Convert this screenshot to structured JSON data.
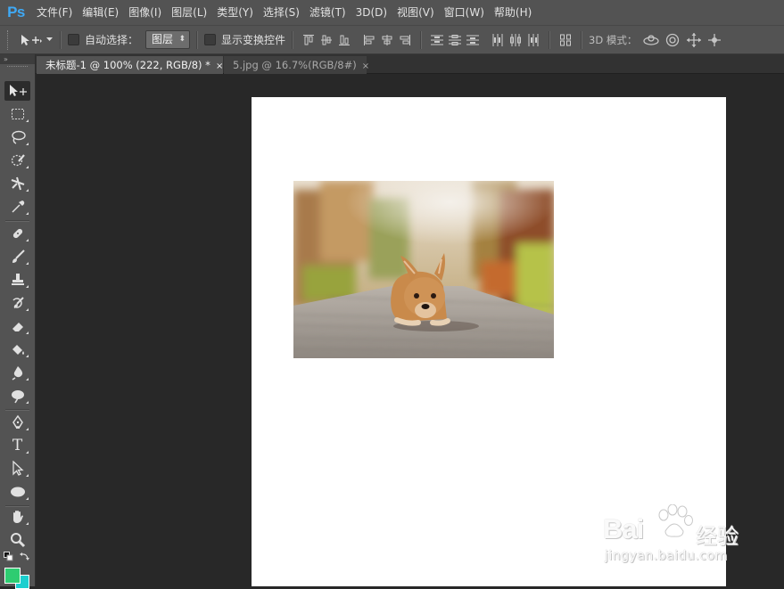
{
  "app": {
    "logo": "Ps"
  },
  "menu": [
    "文件(F)",
    "编辑(E)",
    "图像(I)",
    "图层(L)",
    "类型(Y)",
    "选择(S)",
    "滤镜(T)",
    "3D(D)",
    "视图(V)",
    "窗口(W)",
    "帮助(H)"
  ],
  "options": {
    "auto_select_label": "自动选择：",
    "auto_select_checked": false,
    "auto_select_target": "图层",
    "show_transform_label": "显示变换控件",
    "show_transform_checked": false,
    "mode_3d_label": "3D 模式："
  },
  "toolbox": {
    "collapse_glyph": "»"
  },
  "tabs": [
    {
      "title": "未标题-1 @ 100% (222, RGB/8) *",
      "close": "×",
      "active": true
    },
    {
      "title": "5.jpg @ 16.7%(RGB/8#)",
      "close": "×",
      "active": false
    }
  ],
  "colors": {
    "foreground": "#2ecc71",
    "background": "#1ccfcf",
    "accent": "#3fa9f5"
  },
  "tools": [
    "move-tool",
    "marquee-tool",
    "lasso-tool",
    "quick-selection-tool",
    "crop-tool",
    "eyedropper-tool",
    "healing-brush-tool",
    "brush-tool",
    "clone-stamp-tool",
    "history-brush-tool",
    "eraser-tool",
    "paint-bucket-tool",
    "blur-tool",
    "dodge-tool",
    "pen-tool",
    "type-tool",
    "path-selection-tool",
    "ellipse-tool",
    "hand-tool",
    "zoom-tool"
  ],
  "type_tool_glyph": "T",
  "watermark": {
    "brand": "Bai",
    "brand_suffix": "经验",
    "url": "jingyan.baidu.com"
  }
}
